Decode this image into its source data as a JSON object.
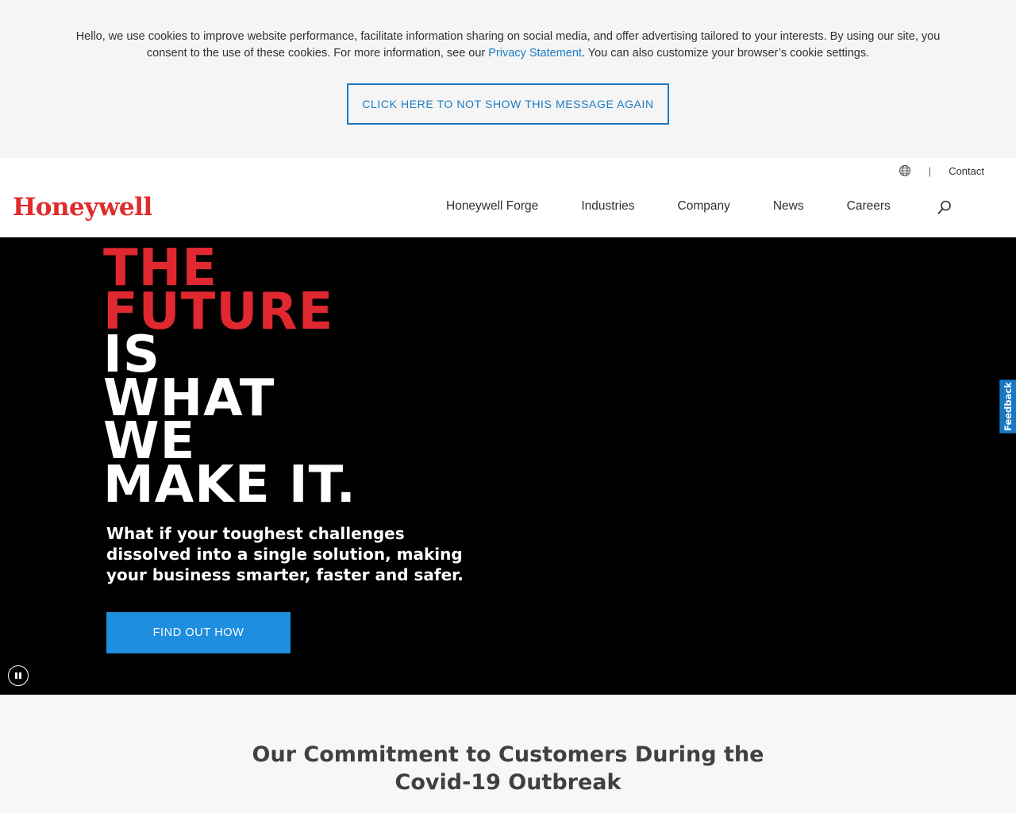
{
  "cookie_banner": {
    "text_before_link": "Hello, we use cookies to improve website performance, facilitate information sharing on social media, and offer advertising tailored to your interests. By using our site, you consent to the use of these cookies. For more information, see our ",
    "link_label": "Privacy Statement",
    "text_after_link": ". You can also customize your browser’s cookie settings.",
    "dismiss_label": "CLICK HERE TO NOT SHOW THIS MESSAGE AGAIN"
  },
  "header": {
    "utility": {
      "separator": "|",
      "contact_label": "Contact"
    },
    "logo_text": "Honeywell",
    "nav": [
      {
        "label": "Honeywell Forge"
      },
      {
        "label": "Industries"
      },
      {
        "label": "Company"
      },
      {
        "label": "News"
      },
      {
        "label": "Careers"
      }
    ]
  },
  "hero": {
    "headline_red": [
      "THE",
      "FUTURE"
    ],
    "headline_white": [
      "IS",
      "WHAT",
      "WE",
      "MAKE IT."
    ],
    "subtext": "What if your toughest challenges dissolved into a single solution, making your business smarter, faster and safer.",
    "cta_label": "FIND OUT HOW"
  },
  "feedback_label": "Feedback",
  "covid_section": {
    "title": "Our Commitment to Customers During the Covid-19 Outbreak"
  },
  "colors": {
    "brand_red": "#e12b2b",
    "link_blue": "#1c7bc2",
    "cta_blue": "#1e8ee0",
    "hero_bg": "#000000"
  },
  "icons": [
    "globe-icon",
    "search-icon",
    "pause-icon"
  ]
}
